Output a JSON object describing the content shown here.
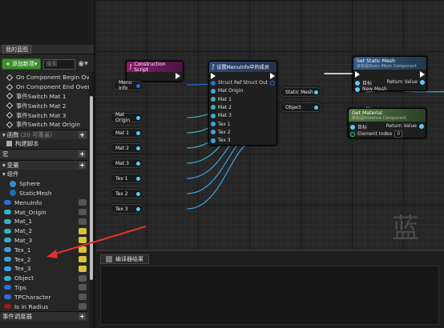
{
  "panel": {
    "tab_label": "我的蓝图"
  },
  "toolbar": {
    "add_label": "添加新项",
    "search_placeholder": "搜索",
    "eye": "◉▾"
  },
  "events": [
    "On Component Begin Ov",
    "On Component End Over",
    "事件Switch Mat 1",
    "事件Switch Mat 2",
    "事件Switch Mat 3",
    "事件Switch Mat Origin"
  ],
  "sections": {
    "functions": "函数",
    "functions_count": "(20 可覆盖)",
    "construct": "构建脚本",
    "macros": "宏",
    "variables": "变量",
    "components": "组件",
    "dispatchers": "事件调度器"
  },
  "components": [
    "Sphere",
    "StaticMesh"
  ],
  "variables": [
    {
      "name": "MenuInfo",
      "color": "#2b6fd6",
      "eye": "gray"
    },
    {
      "name": "Mat_Origin",
      "color": "#3ab0c8",
      "eye": "gray"
    },
    {
      "name": "Mat_1",
      "color": "#3ab0c8",
      "eye": "gray"
    },
    {
      "name": "Mat_2",
      "color": "#3ab0c8",
      "eye": "yellow"
    },
    {
      "name": "Mat_3",
      "color": "#3ab0c8",
      "eye": "yellow"
    },
    {
      "name": "Tex_1",
      "color": "#3aa0e8",
      "eye": "yellow"
    },
    {
      "name": "Tex_2",
      "color": "#3aa0e8",
      "eye": "yellow"
    },
    {
      "name": "Tex_3",
      "color": "#3aa0e8",
      "eye": "yellow"
    },
    {
      "name": "Object",
      "color": "#3ab0c8",
      "eye": "gray"
    },
    {
      "name": "Tips",
      "color": "#2b6fd6",
      "eye": "gray"
    },
    {
      "name": "TPCharacter",
      "color": "#2b6fd6",
      "eye": "gray"
    },
    {
      "name": "Is in Radius",
      "color": "#a01818",
      "eye": "gray"
    }
  ],
  "graph": {
    "construction_script": "Construction Script",
    "set_node_title": "设置MenuInfo中的成员",
    "set_pins_in": [
      "Struct Ref",
      "Mat Origin",
      "Mat 1",
      "Mat 2",
      "Mat 3",
      "Tex 1",
      "Tex 2",
      "Tex 3"
    ],
    "set_pin_out": "Struct Out",
    "set_static_mesh": {
      "title": "Set Static Mesh",
      "subtitle": "目标是Static Mesh Component",
      "target": "目标",
      "new_mesh": "New Mesh",
      "return": "Return Value"
    },
    "get_material": {
      "title": "Get Material",
      "subtitle": "目标是Primitive Component",
      "target": "目标",
      "element": "Element Index",
      "element_value": "0",
      "return": "Return Value"
    },
    "getters": {
      "menu_info": "Menu Info",
      "mat_origin": "Mat Origin",
      "mat_1": "Mat 1",
      "mat_2": "Mat 2",
      "mat_3": "Mat 3",
      "tex_1": "Tex 1",
      "tex_2": "Tex 2",
      "tex_3": "Tex 3",
      "static_mesh": "Static Mesh",
      "object": "Object"
    },
    "watermark": "蓝图"
  },
  "compiler": {
    "tab_label": "编译器结果"
  }
}
